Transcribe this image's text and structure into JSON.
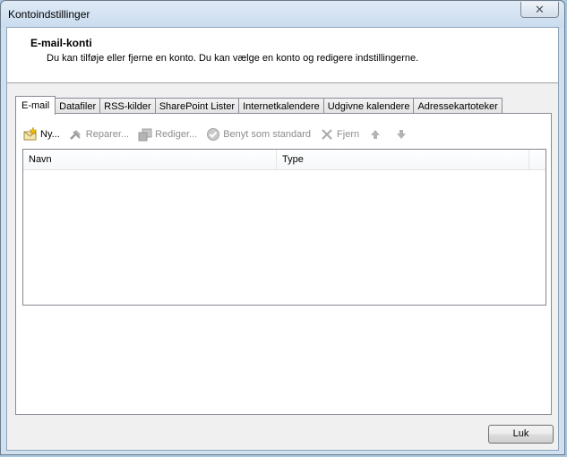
{
  "window": {
    "title": "Kontoindstillinger"
  },
  "header": {
    "title": "E-mail-konti",
    "description": "Du kan tilføje eller fjerne en konto. Du kan vælge en konto og redigere indstillingerne."
  },
  "tabs": [
    {
      "label": "E-mail",
      "active": true
    },
    {
      "label": "Datafiler"
    },
    {
      "label": "RSS-kilder"
    },
    {
      "label": "SharePoint Lister"
    },
    {
      "label": "Internetkalendere"
    },
    {
      "label": "Udgivne kalendere"
    },
    {
      "label": "Adressekartoteker"
    }
  ],
  "toolbar": {
    "new_label": "Ny...",
    "repair_label": "Reparer...",
    "edit_label": "Rediger...",
    "default_label": "Benyt som standard",
    "remove_label": "Fjern"
  },
  "list": {
    "columns": {
      "name": "Navn",
      "type": "Type"
    },
    "rows": []
  },
  "footer": {
    "close_label": "Luk"
  }
}
